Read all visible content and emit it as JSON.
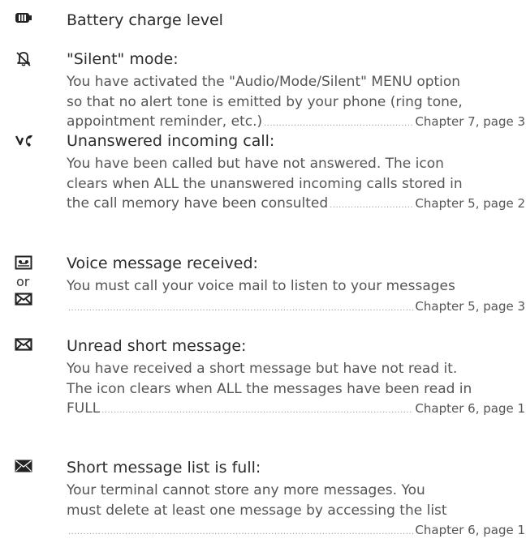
{
  "entries": [
    {
      "icon": "battery-icon",
      "title": "Battery charge level",
      "lines": [],
      "ref_prefix": null,
      "ref": null
    },
    {
      "icon": "bell-slash-icon",
      "title": "\"Silent\" mode:",
      "lines": [
        "You have activated the \"Audio/Mode/Silent\" MENU option",
        "so that no alert tone is emitted by your phone (ring tone,"
      ],
      "ref_prefix": "appointment reminder, etc.)",
      "ref": "Chapter 7, page 3"
    },
    {
      "icon": "missed-call-icon",
      "title": "Unanswered incoming call:",
      "lines": [
        "You have been called but have not answered. The icon",
        "clears when ALL the unanswered incoming calls stored in"
      ],
      "ref_prefix": "the call memory have been consulted",
      "ref": "Chapter 5, page 2"
    },
    {
      "icon": "voicemail-icon",
      "alt_icon": "envelope-icon",
      "or_label": "or",
      "title": "Voice message received:",
      "lines": [
        "You must call your voice mail to listen to your messages"
      ],
      "ref_prefix": "",
      "ref": "Chapter 5, page 3"
    },
    {
      "icon": "envelope-icon",
      "title": "Unread short message:",
      "lines": [
        "You have received a short message but have not read it.",
        "The icon clears when ALL the messages have been read in"
      ],
      "ref_prefix": "FULL",
      "ref": "Chapter 6, page 1"
    },
    {
      "icon": "envelope-full-icon",
      "title": "Short message list is full:",
      "lines": [
        "Your terminal cannot store any more messages. You",
        "must delete at least one message by accessing the list"
      ],
      "ref_prefix": "",
      "ref": "Chapter 6, page 1"
    }
  ]
}
